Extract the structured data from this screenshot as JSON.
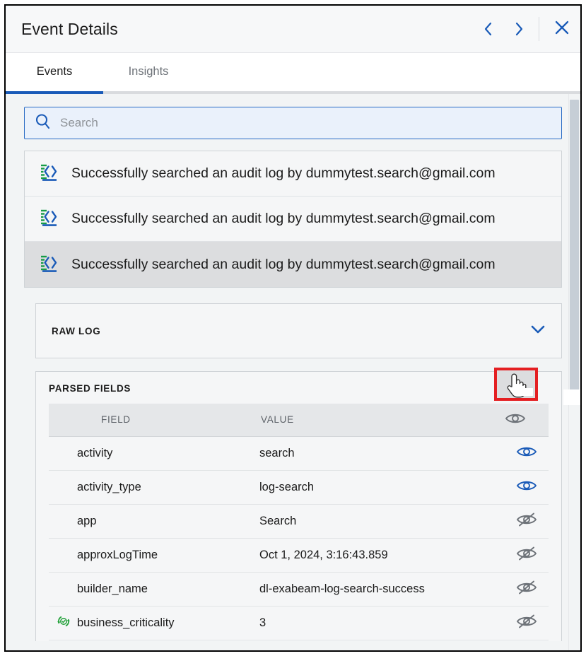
{
  "window": {
    "title": "Event Details",
    "nav_prev_label": "‹",
    "nav_next_label": "›",
    "close_label": "×",
    "icons": {
      "prev": "chevron-left-icon",
      "next": "chevron-right-icon",
      "close": "close-icon"
    }
  },
  "tabs": [
    {
      "label": "Events",
      "active": true
    },
    {
      "label": "Insights",
      "active": false
    }
  ],
  "search": {
    "placeholder": "Search",
    "value": "",
    "icon": "search-icon"
  },
  "events": [
    {
      "label": "Successfully searched an audit log by dummytest.search@gmail.com",
      "icon": "log-code-icon",
      "selected": false
    },
    {
      "label": "Successfully searched an audit log by dummytest.search@gmail.com",
      "icon": "log-code-icon",
      "selected": false
    },
    {
      "label": "Successfully searched an audit log by dummytest.search@gmail.com",
      "icon": "log-code-icon",
      "selected": true
    }
  ],
  "raw_log": {
    "title": "RAW LOG",
    "expanded": false,
    "chevron_icon": "chevron-down-icon"
  },
  "parsed_fields": {
    "title": "PARSED FIELDS",
    "columns": {
      "field": "FIELD",
      "value": "VALUE",
      "visibility_icon": "eye-icon"
    },
    "rows": [
      {
        "field": "activity",
        "value": "search",
        "visible": true,
        "eye_icon": "eye-icon",
        "enriched": false
      },
      {
        "field": "activity_type",
        "value": "log-search",
        "visible": true,
        "eye_icon": "eye-icon",
        "enriched": false
      },
      {
        "field": "app",
        "value": "Search",
        "visible": false,
        "eye_icon": "eye-off-icon",
        "enriched": false
      },
      {
        "field": "approxLogTime",
        "value": "Oct 1, 2024, 3:16:43.859",
        "visible": false,
        "eye_icon": "eye-off-icon",
        "enriched": false
      },
      {
        "field": "builder_name",
        "value": "dl-exabeam-log-search-success",
        "visible": false,
        "eye_icon": "eye-off-icon",
        "enriched": false
      },
      {
        "field": "business_criticality",
        "value": "3",
        "visible": false,
        "eye_icon": "eye-off-icon",
        "enriched": true,
        "enrich_icon": "enrichment-refresh-icon"
      }
    ]
  },
  "cursor": {
    "icon": "pointing-hand-cursor",
    "highlight_color": "#e41f22"
  },
  "colors": {
    "accent": "#1a5bb8",
    "panel_bg": "#f2f4f5",
    "card_bg": "#f5f6f7",
    "selected_row": "#dcdddf",
    "eye_on": "#1a5bb8",
    "eye_off": "#6d7278",
    "enrich_green": "#21a038",
    "icon_green": "#169b47"
  },
  "scrollbar": {
    "orientation": "vertical"
  }
}
